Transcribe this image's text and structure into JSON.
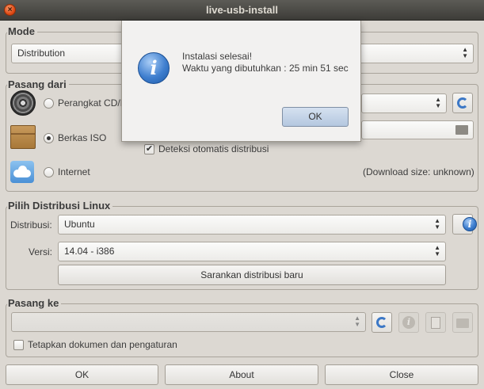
{
  "window": {
    "title": "live-usb-install",
    "close_glyph": "×"
  },
  "mode": {
    "group_title": "Mode",
    "combo_value": "Distribution"
  },
  "source": {
    "group_title": "Pasang dari",
    "cd_label": "Perangkat CD/D",
    "iso_label": "Berkas ISO",
    "internet_label": "Internet",
    "autodetect_label": "Deteksi otomatis distribusi",
    "download_size": "(Download size: unknown)"
  },
  "distro": {
    "group_title": "Pilih Distribusi Linux",
    "distribution_label": "Distribusi:",
    "distribution_value": "Ubuntu",
    "version_label": "Versi:",
    "version_value": "14.04 - i386",
    "suggest_button": "Sarankan distribusi baru"
  },
  "target": {
    "group_title": "Pasang ke",
    "persist_label": "Tetapkan dokumen dan pengaturan"
  },
  "footer": {
    "ok": "OK",
    "about": "About",
    "close": "Close"
  },
  "dialog": {
    "line1": "Instalasi selesai!",
    "line2": "Waktu yang dibutuhkan : 25 min 51 sec",
    "ok": "OK"
  },
  "icons": {
    "info_glyph": "i",
    "arrows_glyph": "▲▼",
    "check_glyph": "✔"
  }
}
